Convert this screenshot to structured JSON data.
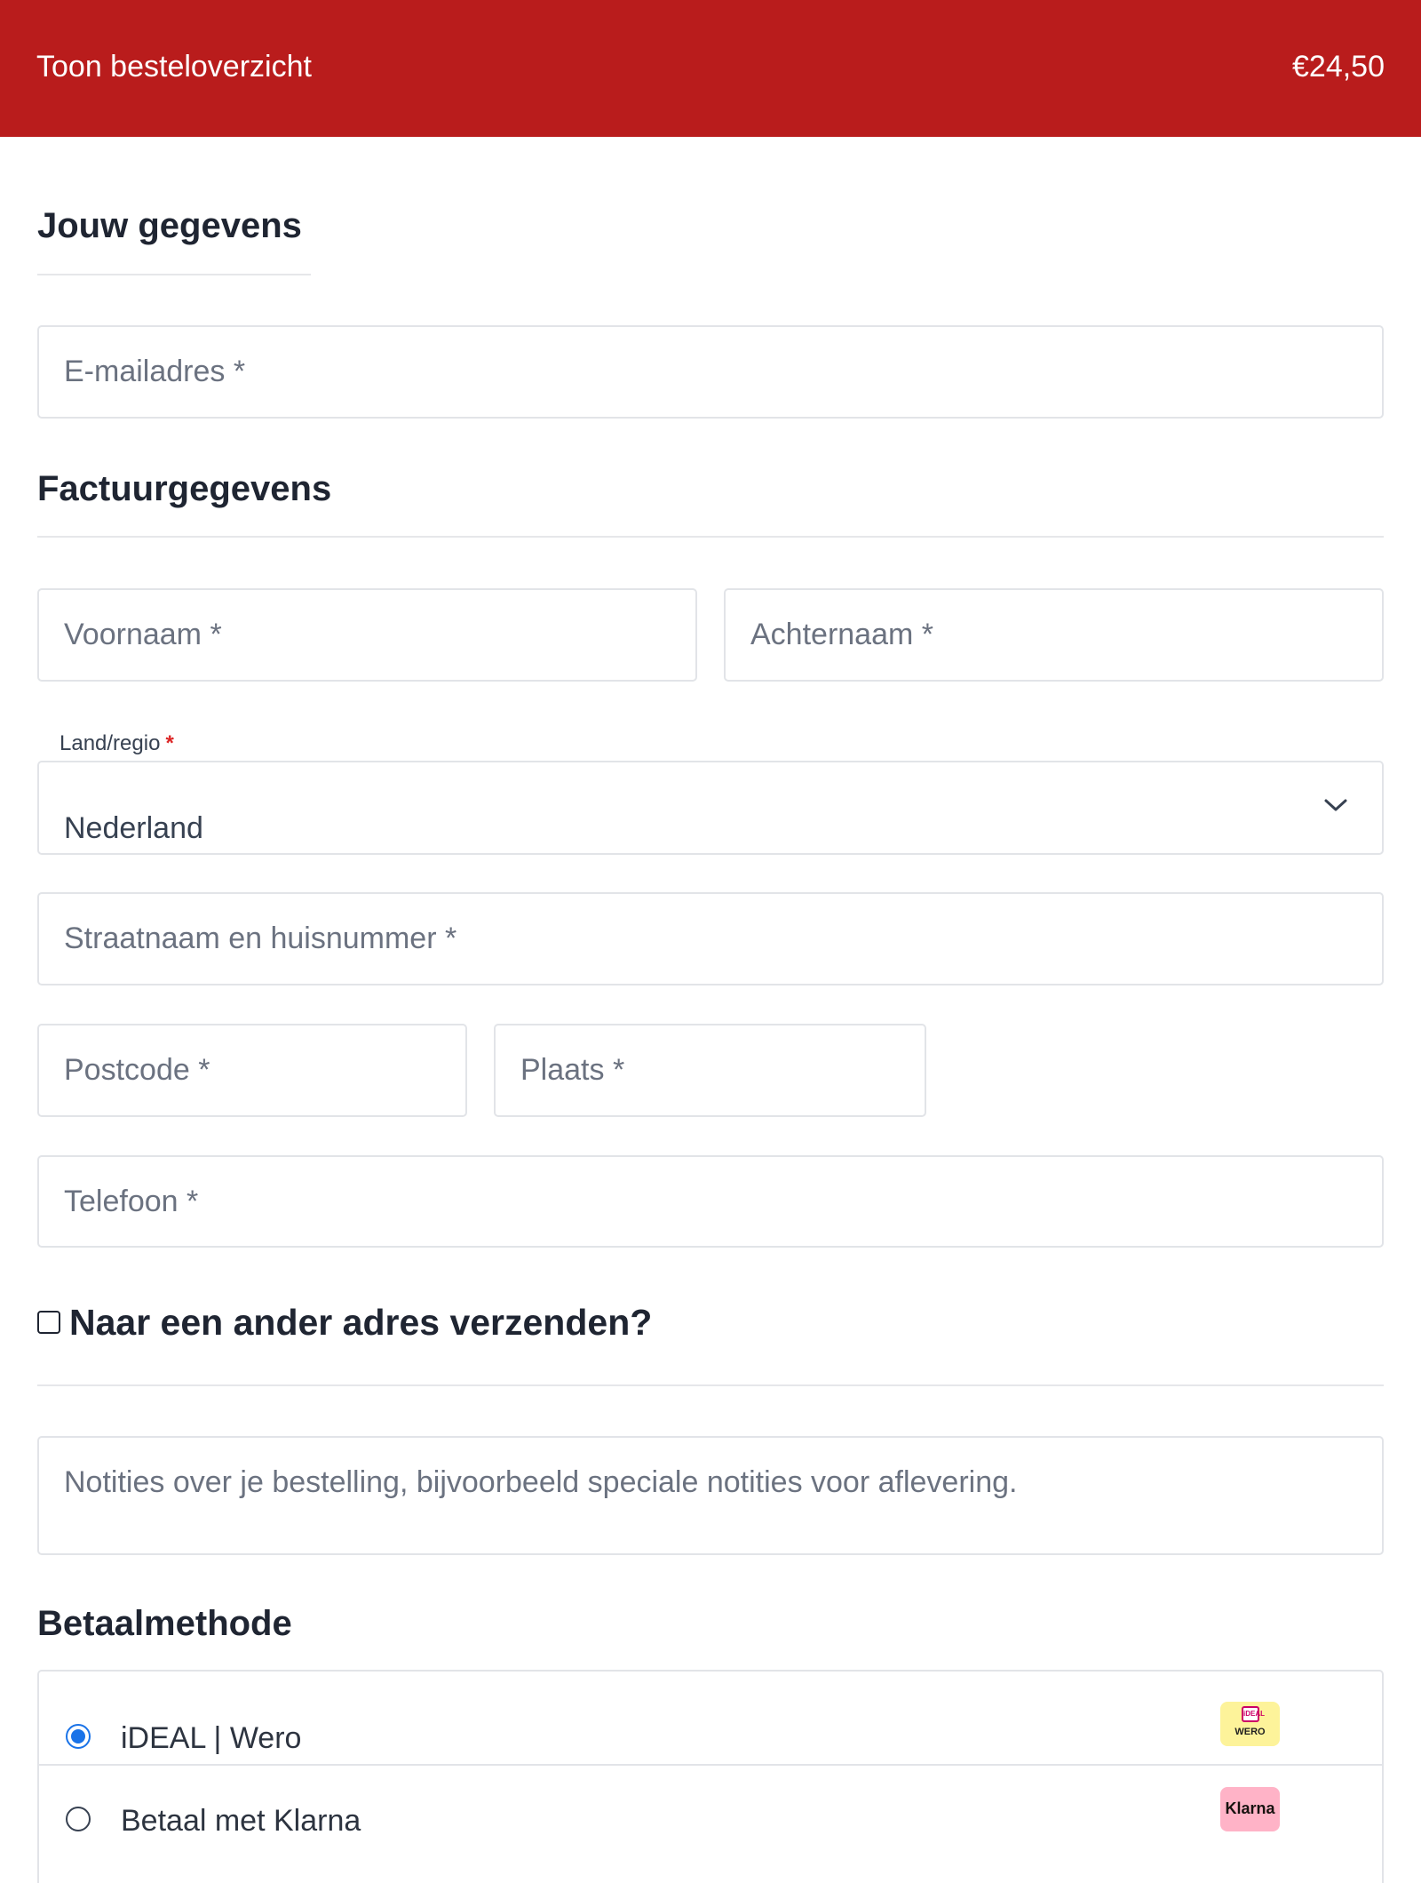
{
  "summary_bar": {
    "toggle_label": "Toon besteloverzicht",
    "order_total": "€24,50",
    "color": "#b91c1c"
  },
  "contact": {
    "heading": "Jouw gegevens",
    "email_placeholder": "E-mailadres *"
  },
  "billing": {
    "heading": "Factuurgegevens",
    "first_name_placeholder": "Voornaam *",
    "last_name_placeholder": "Achternaam *",
    "country_label": "Land/regio",
    "country_required": "*",
    "country_value": "Nederland",
    "street_placeholder": "Straatnaam en huisnummer *",
    "postcode_placeholder": "Postcode *",
    "city_placeholder": "Plaats *",
    "phone_placeholder": "Telefoon *"
  },
  "shipping": {
    "different_address_label": "Naar een ander adres verzenden?",
    "checked": false
  },
  "notes": {
    "placeholder": "Notities over je bestelling, bijvoorbeeld speciale notities voor aflevering."
  },
  "payment": {
    "heading": "Betaalmethode",
    "methods": [
      {
        "name": "iDEAL | Wero",
        "selected": true,
        "icon": "ideal-wero-logo",
        "logo_mark": "iDEAL",
        "logo_text": "WERO"
      },
      {
        "name": "Betaal met Klarna",
        "selected": false,
        "icon": "klarna-logo",
        "logo_text": "Klarna"
      }
    ],
    "accent_color": "#1a73e8"
  }
}
